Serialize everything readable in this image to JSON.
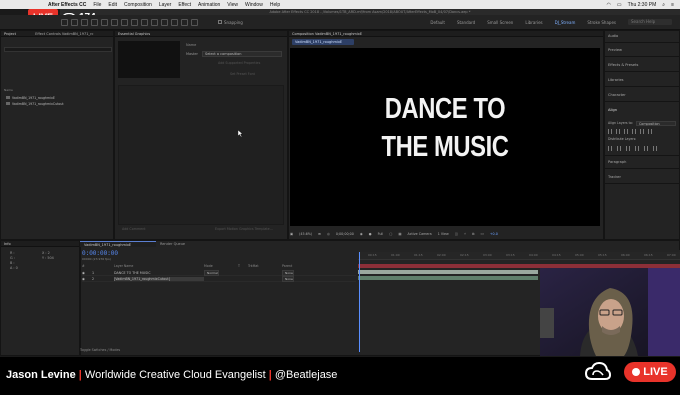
{
  "menu": {
    "app_name": "After Effects CC",
    "items": [
      "File",
      "Edit",
      "Composition",
      "Layer",
      "Effect",
      "Animation",
      "View",
      "Window",
      "Help"
    ],
    "time": "Thu 2:30 PM"
  },
  "stream": {
    "live_label": "LIVE",
    "viewers": "174",
    "live_color": "#e8332a"
  },
  "window_title": "Adobe After Effects CC 2018 - /Volumes/1TB_ARD-mf/from Asam/2018/ABOUT/AfterEffects_MoB_04/07/Dancs.aep *",
  "toolbar": {
    "snapping": "Snapping",
    "workspaces": [
      "Default",
      "Standard",
      "Small Screen",
      "Libraries",
      "DJ_Stream",
      "Stroke Shapes"
    ],
    "active_workspace": "DJ_Stream",
    "search_placeholder": "Search Help"
  },
  "project": {
    "tab": "Project",
    "effect_tab": "Effect Controls VadimBN_1971_rc",
    "column": "Name",
    "items": [
      "VadimBN_1971_roughmixE",
      "VadimBN_1971_roughmixCutout"
    ]
  },
  "essential_graphics": {
    "tab": "Essential Graphics",
    "master_label": "Name",
    "master_field": "Master",
    "select_value": "Select a composition",
    "add_props": "Add Supported Properties",
    "no_font": "Set Preset Font",
    "add_comment": "Add Comment",
    "export": "Export Motion Graphics Template..."
  },
  "composition": {
    "tab": "Composition VadimBN_1971_roughmixE",
    "subtab": "VadimBN_1971_roughmixE",
    "text_line1": "DANCE TO",
    "text_line2": "THE MUSIC",
    "zoom": "(45.6%)",
    "time": "0;00;00;00",
    "resolution": "Full",
    "camera": "Active Camera",
    "view": "1 View",
    "exposure": "+0.0"
  },
  "right_panel": {
    "items": [
      "Audio",
      "Preview",
      "Effects & Presets",
      "Libraries",
      "Character",
      "Align",
      "Paragraph",
      "Tracker"
    ],
    "align_to_label": "Align Layers to:",
    "align_to_value": "Composition",
    "distribute": "Distribute Layers:"
  },
  "info": {
    "tab": "Info",
    "rgba": "R :\nG :\nB :\nA : 0",
    "coords": "X : 2\nY : 504"
  },
  "timeline": {
    "tab": "VadimBN_1971_roughmixE",
    "render_queue": "Render Queue",
    "time": "0:00:00:00",
    "frames": "00000 (23.976 fps)",
    "headers": [
      "#",
      "Layer Name",
      "Mode",
      "T",
      "TrkMat",
      "Parent"
    ],
    "layers": [
      {
        "num": "1",
        "name": "DANCE TO THE MUSIC",
        "mode": "Normal",
        "trkmat": "",
        "parent": "None"
      },
      {
        "num": "2",
        "name": "[VadimBN_1971_roughmixCutout]",
        "mode": "",
        "trkmat": "",
        "parent": "None"
      }
    ],
    "ruler_ticks": [
      "00:15",
      "01:00",
      "01:15",
      "02:00",
      "02:15",
      "03:00",
      "03:15",
      "04:00",
      "04:15",
      "05:00",
      "05:15",
      "06:00",
      "06:15",
      "07:00"
    ],
    "bottom": "Toggle Switches / Modes"
  },
  "lower_third": {
    "name": "Jason Levine",
    "title": "Worldwide Creative Cloud Evangelist",
    "handle": "@Beatlejase",
    "live_label": "LIVE"
  }
}
